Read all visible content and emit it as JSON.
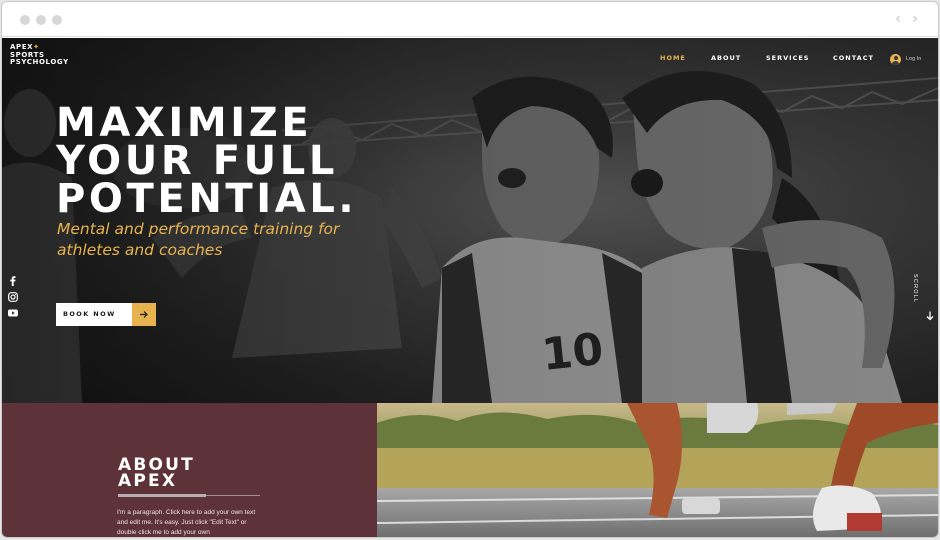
{
  "browser": {
    "back_icon": "chevron-left-icon",
    "forward_icon": "chevron-right-icon"
  },
  "site": {
    "logo_lines": [
      "APEX",
      "SPORTS",
      "PSYCHOLOGY"
    ],
    "logo_star": "✦"
  },
  "nav": {
    "items": [
      {
        "label": "HOME",
        "active": true
      },
      {
        "label": "ABOUT",
        "active": false
      },
      {
        "label": "SERVICES",
        "active": false
      },
      {
        "label": "CONTACT",
        "active": false
      }
    ],
    "login_label": "Log In"
  },
  "hero": {
    "headline": [
      "MAXIMIZE",
      "YOUR FULL",
      "POTENTIAL."
    ],
    "subheadline": "Mental and performance training for athletes and coaches",
    "cta_label": "BOOK NOW",
    "scroll_label": "SCROLL",
    "jersey_number": "10",
    "social_icons": [
      "facebook-icon",
      "instagram-icon",
      "youtube-icon"
    ]
  },
  "about": {
    "title_lines": [
      "ABOUT",
      "APEX"
    ],
    "paragraph": "I'm a paragraph. Click here to add your own text and edit me. It's easy. Just click \"Edit Text\" or double click me to add your own"
  },
  "colors": {
    "accent": "#e7b34f",
    "about_bg": "#5d3238",
    "hero_dark": "#262626"
  }
}
